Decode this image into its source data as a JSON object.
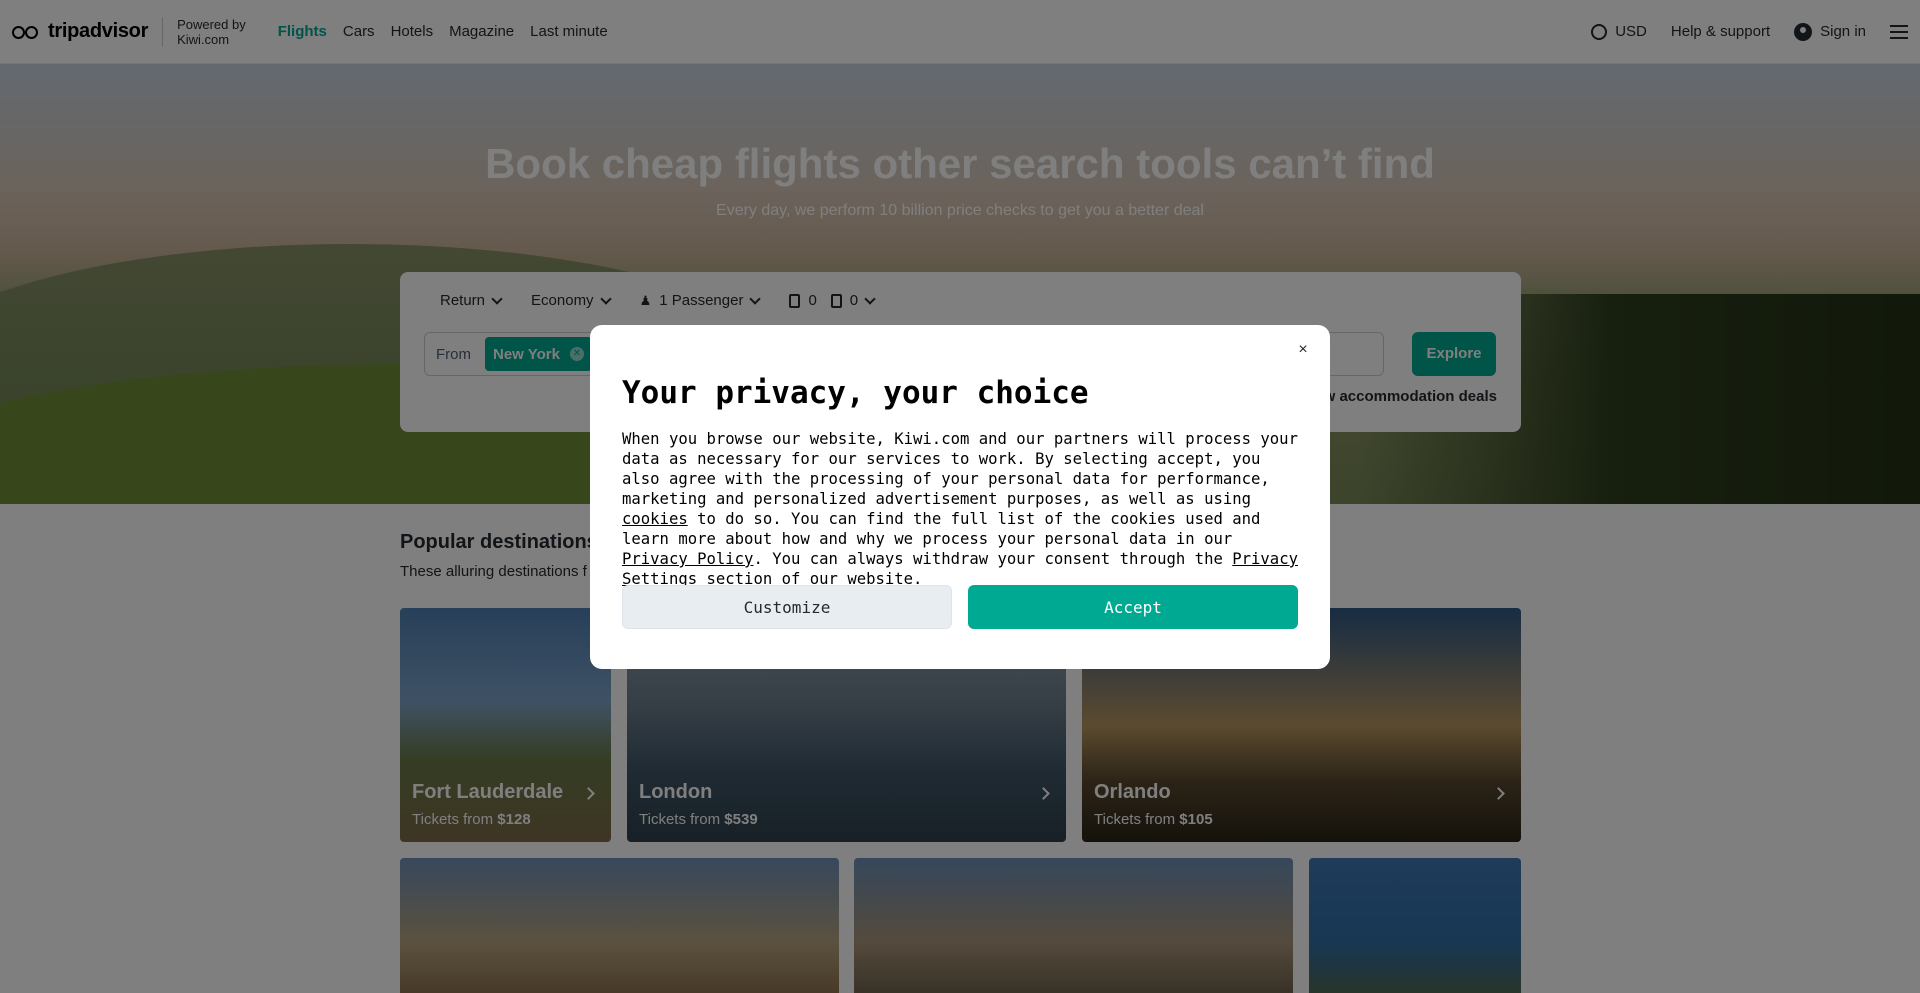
{
  "header": {
    "brand": "tripadvisor",
    "powered_by": "Powered by",
    "powered_by_site": "Kiwi.com",
    "nav": [
      "Flights",
      "Cars",
      "Hotels",
      "Magazine",
      "Last minute"
    ],
    "currency": "USD",
    "help": "Help & support",
    "sign_in": "Sign in"
  },
  "hero": {
    "title": "Book cheap flights other search tools can’t find",
    "subtitle": "Every day, we perform 10 billion price checks to get you a better deal"
  },
  "search": {
    "trip_type": "Return",
    "cabin": "Economy",
    "passengers": "1 Passenger",
    "cabin_bags": "0",
    "checked_bags": "0",
    "from_label": "From",
    "from_value": "New York",
    "explore_label": "Explore",
    "accommodation_label": "w accommodation deals"
  },
  "popular": {
    "title": "Popular destinations",
    "subtitle": "These alluring destinations f",
    "cards": [
      {
        "name": "Fort Lauderdale",
        "price_prefix": "Tickets from",
        "price": "$128"
      },
      {
        "name": "London",
        "price_prefix": "Tickets from",
        "price": "$539"
      },
      {
        "name": "Orlando",
        "price_prefix": "Tickets from",
        "price": "$105"
      }
    ]
  },
  "modal": {
    "title": "Your privacy, your choice",
    "body_1": "When you browse our website, Kiwi.com and our partners will process your data as necessary for our services to work. By selecting accept, you also agree with the processing of your personal data for performance, marketing and personalized advertisement purposes, as well as using ",
    "cookies_link": "cookies",
    "body_2": " to do so. You can find the full list of the cookies used and learn more about how and why we process your personal data in our ",
    "privacy_link": "Privacy Policy",
    "body_3": ". You can always withdraw your consent through the ",
    "settings_link": "Privacy Settings",
    "body_4": " section of our website.",
    "customize_label": "Customize",
    "accept_label": "Accept",
    "close_label": "×"
  },
  "colors": {
    "brand_green": "#00a991",
    "text": "#252a31",
    "overlay": "rgba(0,0,0,0.5)"
  },
  "icons": [
    "tripadvisor-logo-icon",
    "globe-icon",
    "user-icon",
    "menu-icon",
    "chevron-down-icon",
    "person-icon",
    "cabin-bag-icon",
    "checked-bag-icon",
    "clear-chip-icon",
    "close-icon",
    "chevron-right-icon"
  ]
}
